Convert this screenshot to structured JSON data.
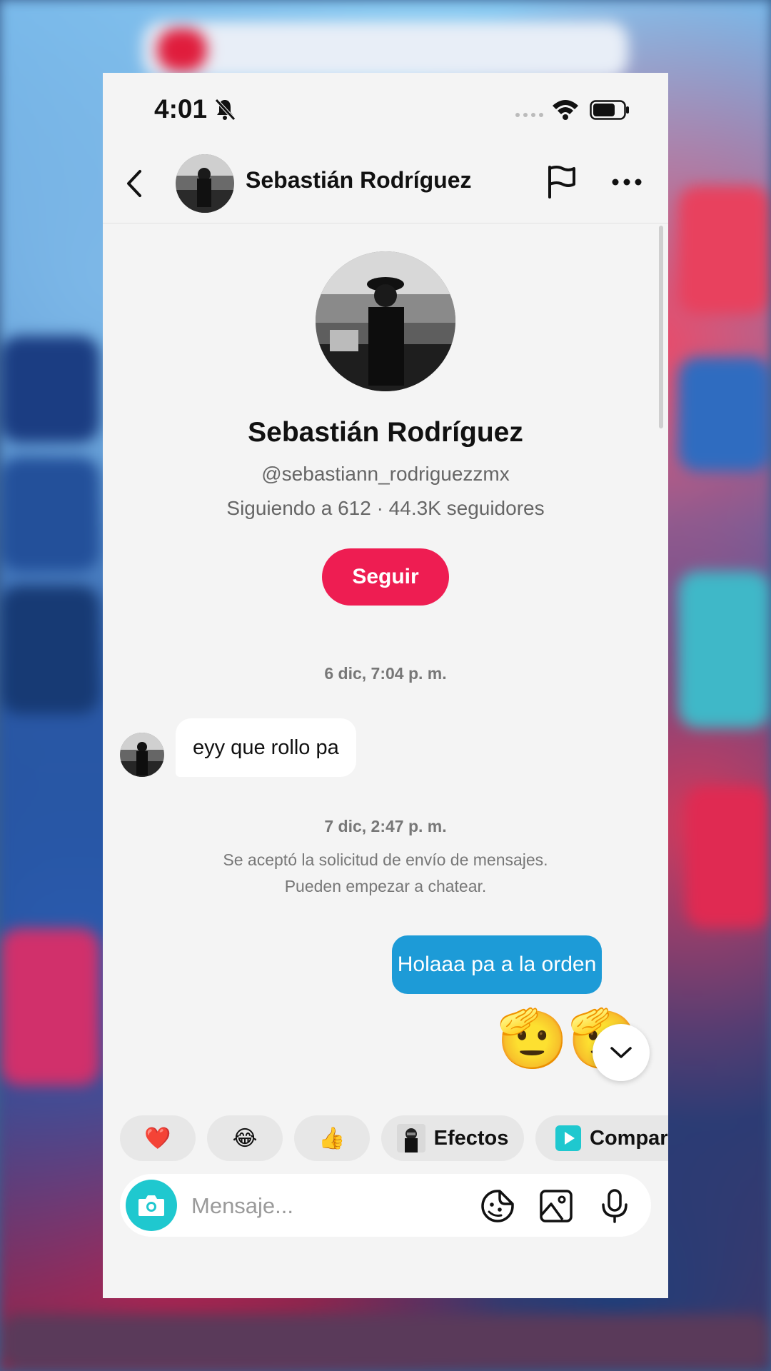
{
  "status_bar": {
    "time": "4:01"
  },
  "header": {
    "contact_name": "Sebastián Rodríguez"
  },
  "profile": {
    "name": "Sebastián Rodríguez",
    "handle": "@sebastiann_rodriguezzmx",
    "stats": "Siguiendo a 612 · 44.3K seguidores",
    "follow_label": "Seguir"
  },
  "conversation": {
    "timestamp_1": "6 dic, 7:04 p. m.",
    "incoming_message": "eyy que rollo pa",
    "timestamp_2": "7 dic, 2:47 p. m.",
    "system_line_1": "Se aceptó la solicitud de envío de mensajes.",
    "system_line_2": "Pueden empezar a chatear.",
    "outgoing_message": "Holaaa pa a la orden",
    "outgoing_emojis": "🫡🫡"
  },
  "quick_reactions": [
    {
      "emoji": "❤️"
    },
    {
      "emoji": "😂"
    },
    {
      "emoji": "👍"
    }
  ],
  "quick_actions": {
    "effects_label": "Efectos",
    "share_label": "Compartir"
  },
  "composer": {
    "placeholder": "Mensaje..."
  },
  "colors": {
    "follow_button": "#ee1d52",
    "outgoing_bubble": "#1d9bd7",
    "camera_button": "#1fc8cf"
  }
}
